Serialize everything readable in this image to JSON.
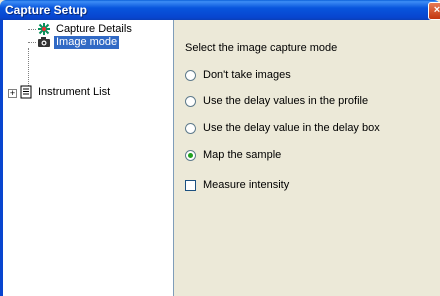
{
  "window": {
    "title": "Capture Setup",
    "close_glyph": "×"
  },
  "tree": {
    "items": [
      {
        "label": "Capture Details",
        "icon": "snowflake-icon",
        "selected": false
      },
      {
        "label": "Image mode",
        "icon": "camera-icon",
        "selected": true
      },
      {
        "label": "Instrument List",
        "icon": "document-icon",
        "selected": false,
        "expander": "+"
      }
    ]
  },
  "panel": {
    "prompt": "Select the image capture mode",
    "options": [
      {
        "label": "Don't take images",
        "checked": false
      },
      {
        "label": "Use the delay values in the profile",
        "checked": false
      },
      {
        "label": "Use the delay value in the delay box",
        "checked": false
      },
      {
        "label": "Map the sample",
        "checked": true
      }
    ],
    "checkbox": {
      "label": "Measure intensity",
      "checked": false
    }
  },
  "colors": {
    "titlebar": "#0855dd",
    "selection": "#316ac5",
    "panel": "#ece9d8",
    "radio_dot": "#21a121"
  }
}
